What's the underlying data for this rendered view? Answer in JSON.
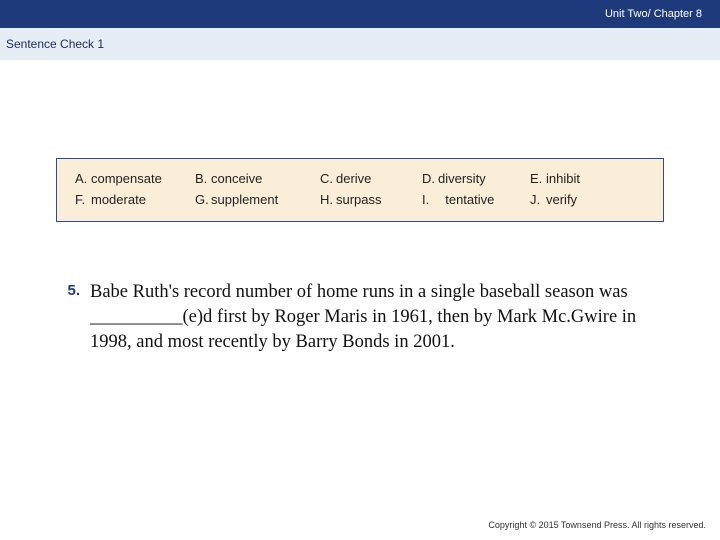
{
  "header": {
    "breadcrumb": "Unit Two/ Chapter 8"
  },
  "subheader": {
    "title": "Sentence Check 1"
  },
  "wordbank": {
    "r1c1_letter": "A.",
    "r1c1_word": "compensate",
    "r1c2_letter": "B.",
    "r1c2_word": "conceive",
    "r1c3_letter": "C.",
    "r1c3_word": "derive",
    "r1c4_letter": "D.",
    "r1c4_word": "diversity",
    "r1c5_letter": "E.",
    "r1c5_word": "inhibit",
    "r2c1_letter": "F.",
    "r2c1_word": "moderate",
    "r2c2_letter": "G.",
    "r2c2_word": "supplement",
    "r2c3_letter": "H.",
    "r2c3_word": "surpass",
    "r2c4_letter": "I.",
    "r2c4_word": "tentative",
    "r2c5_letter": "J.",
    "r2c5_word": "verify"
  },
  "question": {
    "number": "5.",
    "text": "Babe Ruth's record number of home runs in a single baseball season was __________(e)d  first by Roger Maris in 1961, then by Mark Mc.Gwire in 1998, and most recently by Barry Bonds in 2001."
  },
  "footer": {
    "copyright": "Copyright © 2015 Townsend Press. All rights reserved."
  }
}
